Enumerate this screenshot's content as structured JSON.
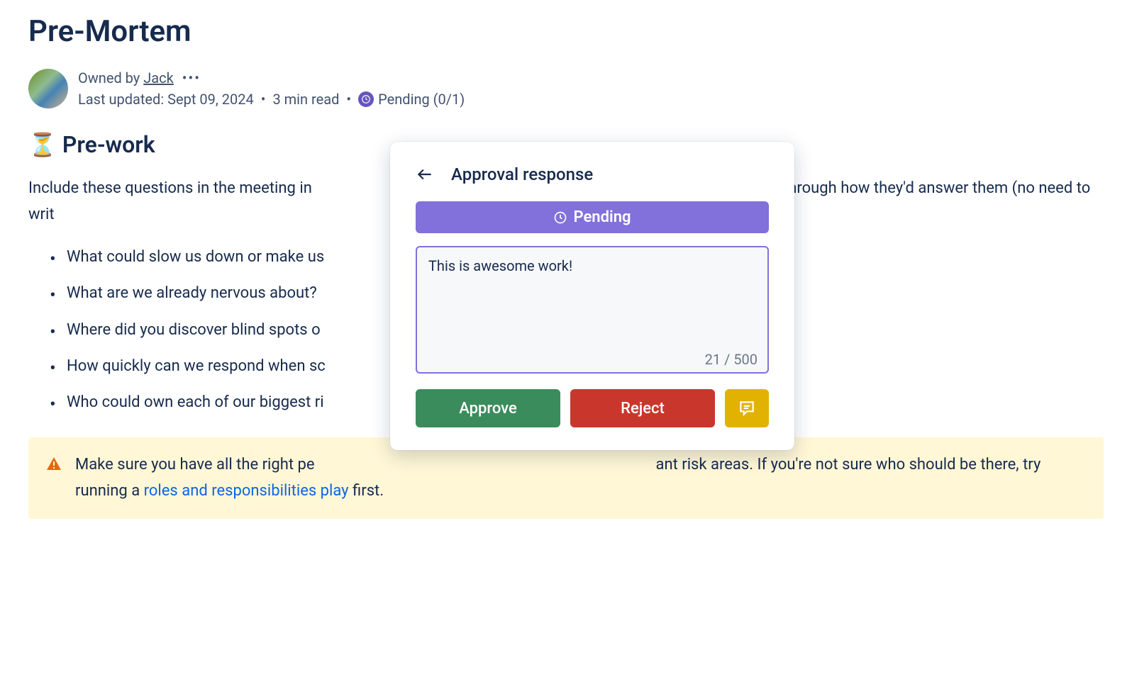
{
  "page": {
    "title": "Pre-Mortem",
    "owner_prefix": "Owned by ",
    "owner_name": "Jack",
    "last_updated_prefix": "Last updated: ",
    "last_updated_date": "Sept 09, 2024",
    "read_time": "3 min read",
    "status_label": "Pending (0/1)"
  },
  "section": {
    "heading_emoji": "⏳",
    "heading_text": "Pre-work",
    "intro_part1": "Include these questions in the meeting in",
    "intro_part2": "thinking through how they'd answer them (no need to writ",
    "questions": [
      "What could slow us down or make us",
      "What are we already nervous about?",
      "Where did you discover blind spots o",
      "How quickly can we respond when sc",
      "Who could own each of our biggest ri"
    ]
  },
  "warning": {
    "text_part1": "Make sure you have all the right pe",
    "text_part2": "ant risk areas. If you're not sure who should be there, try running a ",
    "link_text": "roles and responsibilities play",
    "text_part3": " first."
  },
  "modal": {
    "title": "Approval response",
    "banner_label": "Pending",
    "textarea_value": "This is awesome work!",
    "char_count": "21 / 500",
    "approve_label": "Approve",
    "reject_label": "Reject"
  }
}
